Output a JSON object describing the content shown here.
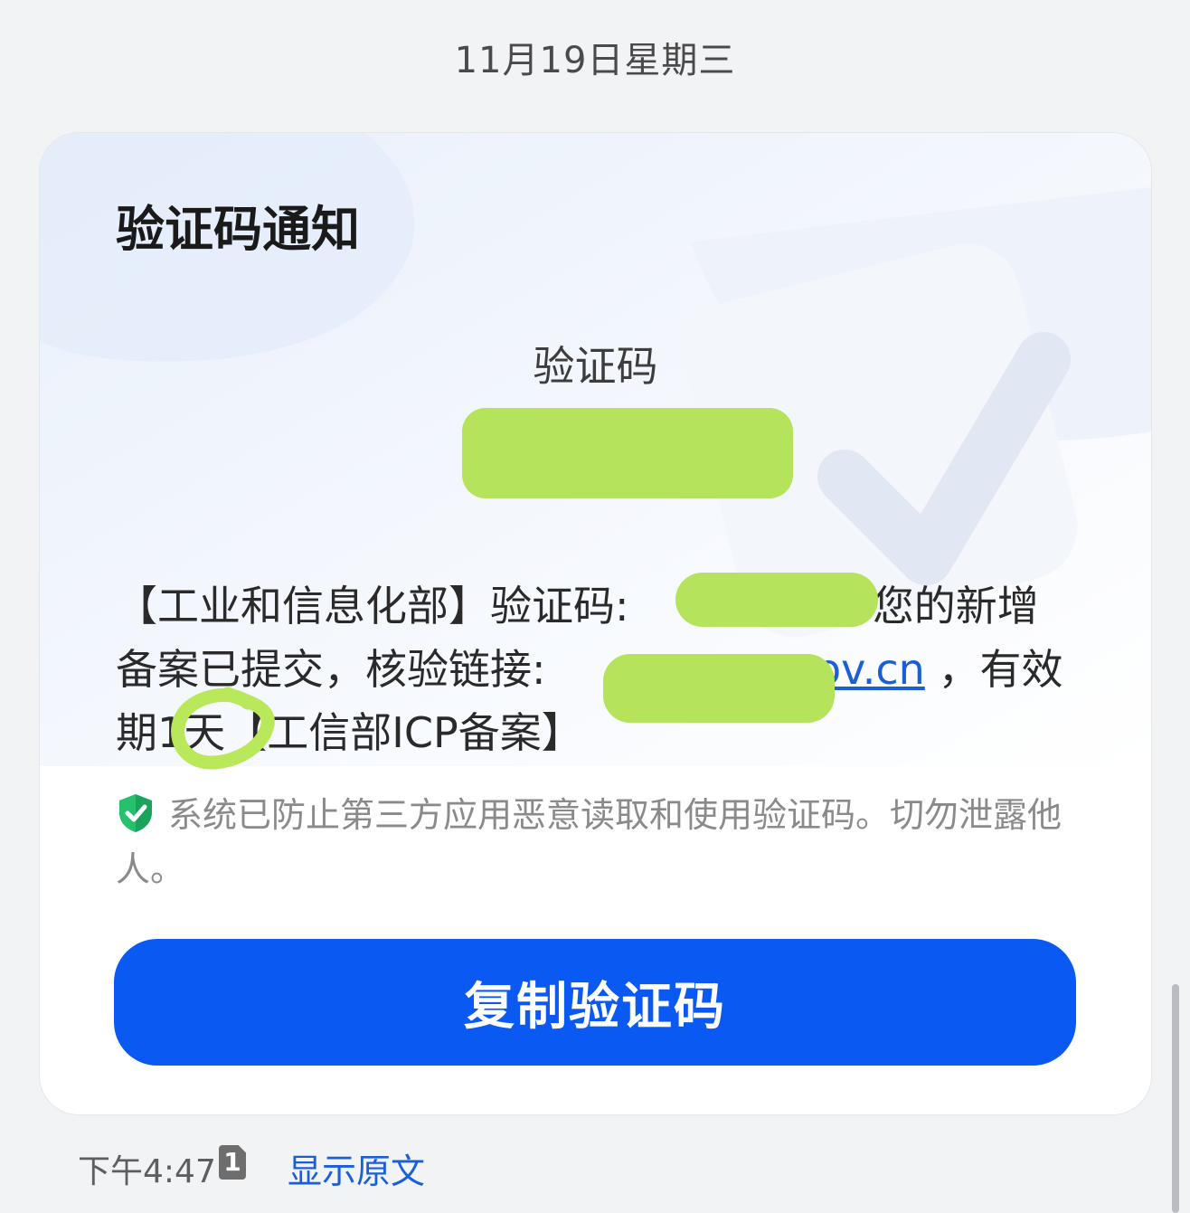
{
  "date_header": "11月19日星期三",
  "card": {
    "title": "验证码通知",
    "code_label": "验证码",
    "code_value": "",
    "message": {
      "line1_before": "【工业和信息化部】验证码:",
      "line1_after": "您的新增",
      "line2_before": "备案已提交，核验链接:",
      "line2_link": "gov.cn",
      "line2_after": "，有效",
      "line3": "期1天【工信部ICP备案】"
    },
    "notice": "系统已防止第三方应用恶意读取和使用验证码。切勿泄露他人。",
    "copy_button": "复制验证码"
  },
  "footer": {
    "time": "下午4:47",
    "sim_label": "1",
    "show_original": "显示原文"
  },
  "colors": {
    "accent_blue": "#0b59f3",
    "link_blue": "#1b5fd8",
    "shield_green": "#1aa35a",
    "redaction_green": "#b5e35c",
    "annotation_green": "#b9e85a"
  },
  "icons": [
    "shield-check-icon",
    "sim-card-icon"
  ]
}
